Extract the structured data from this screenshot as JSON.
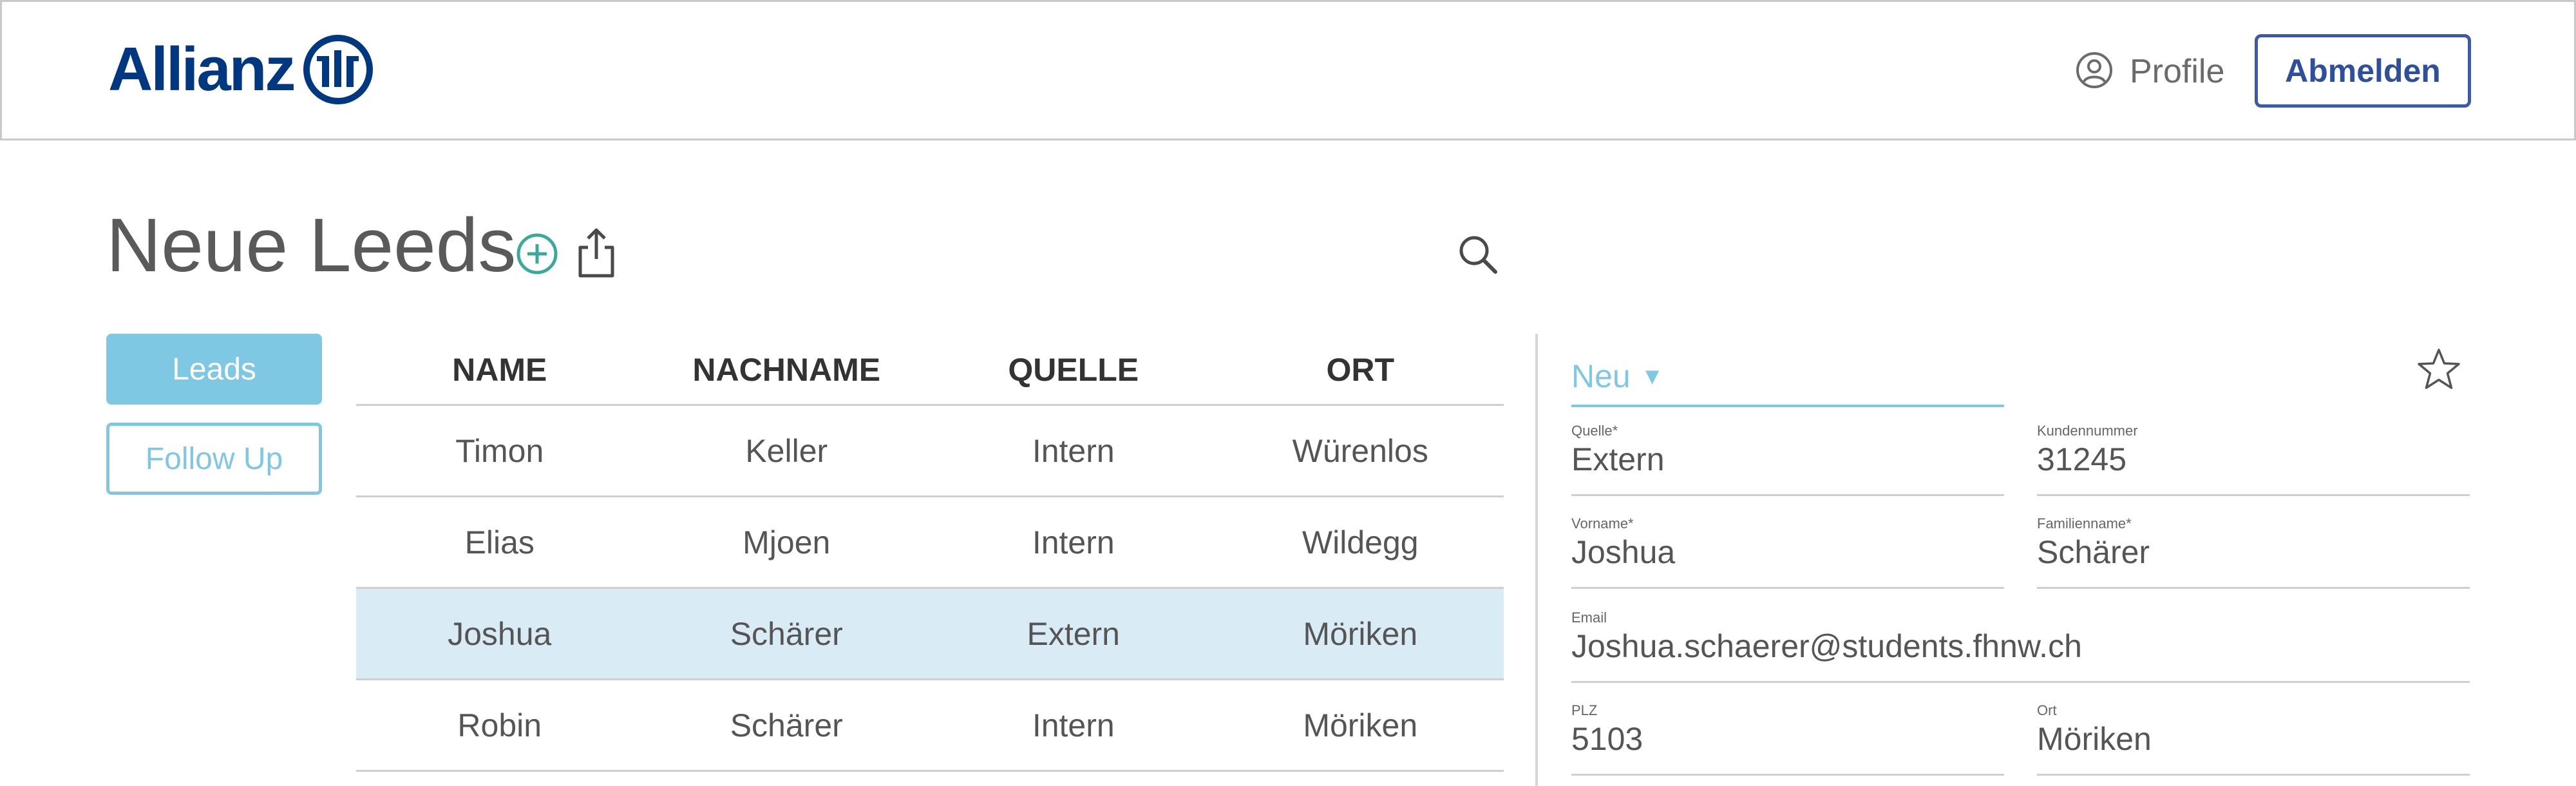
{
  "header": {
    "brand": "Allianz",
    "profile_label": "Profile",
    "logout_label": "Abmelden"
  },
  "page": {
    "title": "Neue Leeds"
  },
  "nav": {
    "leads_label": "Leads",
    "followup_label": "Follow Up"
  },
  "table": {
    "columns": [
      "NAME",
      "NACHNAME",
      "QUELLE",
      "ORT"
    ],
    "rows": [
      [
        "Timon",
        "Keller",
        "Intern",
        "Würenlos"
      ],
      [
        "Elias",
        "Mjoen",
        "Intern",
        "Wildegg"
      ],
      [
        "Joshua",
        "Schärer",
        "Extern",
        "Möriken"
      ],
      [
        "Robin",
        "Schärer",
        "Intern",
        "Möriken"
      ]
    ],
    "selected_row": 2
  },
  "detail": {
    "status": "Neu",
    "fields": {
      "quelle": {
        "label": "Quelle*",
        "value": "Extern"
      },
      "kundennummer": {
        "label": "Kundennummer",
        "value": "31245"
      },
      "vorname": {
        "label": "Vorname*",
        "value": "Joshua"
      },
      "familienname": {
        "label": "Familienname*",
        "value": "Schärer"
      },
      "email": {
        "label": "Email",
        "value": "Joshua.schaerer@students.fhnw.ch"
      },
      "plz": {
        "label": "PLZ",
        "value": "5103"
      },
      "ort": {
        "label": "Ort",
        "value": "Möriken"
      }
    }
  },
  "icons": {
    "logo": "allianz-logo-icon",
    "profile": "user-circle-icon",
    "add": "plus-circle-icon",
    "share": "share-icon",
    "search": "search-icon",
    "caret": "caret-down-icon",
    "favorite": "star-icon"
  },
  "colors": {
    "brand_blue": "#003781",
    "button_blue": "#3b5ba8",
    "accent_light_blue": "#7ec8e3",
    "selected_row_bg": "#d9ecf5",
    "add_icon_teal": "#3aa99a"
  }
}
